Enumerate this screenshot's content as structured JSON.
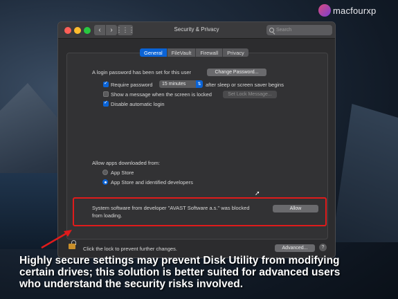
{
  "window": {
    "title": "Security & Privacy",
    "search_placeholder": "Search"
  },
  "tabs": [
    {
      "label": "General",
      "active": true
    },
    {
      "label": "FileVault",
      "active": false
    },
    {
      "label": "Firewall",
      "active": false
    },
    {
      "label": "Privacy",
      "active": false
    }
  ],
  "general": {
    "login_password_text": "A login password has been set for this user",
    "change_password_button": "Change Password...",
    "require_password_label": "Require password",
    "require_password_checked": true,
    "require_password_delay": "15 minutes",
    "require_password_suffix": "after sleep or screen saver begins",
    "show_message_label": "Show a message when the screen is locked",
    "show_message_checked": false,
    "set_lock_message_button": "Set Lock Message...",
    "disable_autologin_label": "Disable automatic login",
    "disable_autologin_checked": true,
    "allow_apps_title": "Allow apps downloaded from:",
    "app_store_option": "App Store",
    "app_store_identified_option": "App Store and identified developers",
    "selected_option": "App Store and identified developers",
    "blocked_message_line1": "System software from developer \"AVAST Software a.s.\" was blocked",
    "blocked_message_line2": "from loading.",
    "allow_button": "Allow"
  },
  "footer": {
    "lock_text": "Click the lock to prevent further changes.",
    "advanced_button": "Advanced...",
    "help_label": "?"
  },
  "logo": {
    "text": "macfourxp"
  },
  "caption": {
    "text": "Highly secure settings may prevent Disk Utility from modifying\ncertain drives; this solution is better suited for advanced users\nwho understand the security risks involved."
  },
  "colors": {
    "accent": "#0a63d6",
    "highlight_box": "#e01b1b",
    "window_bg": "#2c2c2e"
  },
  "icons": {
    "back": "chevron-left-icon",
    "forward": "chevron-right-icon",
    "grid": "grid-icon",
    "search": "search-icon",
    "lock": "lock-icon",
    "help": "help-icon",
    "cursor": "pointer-cursor-icon"
  }
}
